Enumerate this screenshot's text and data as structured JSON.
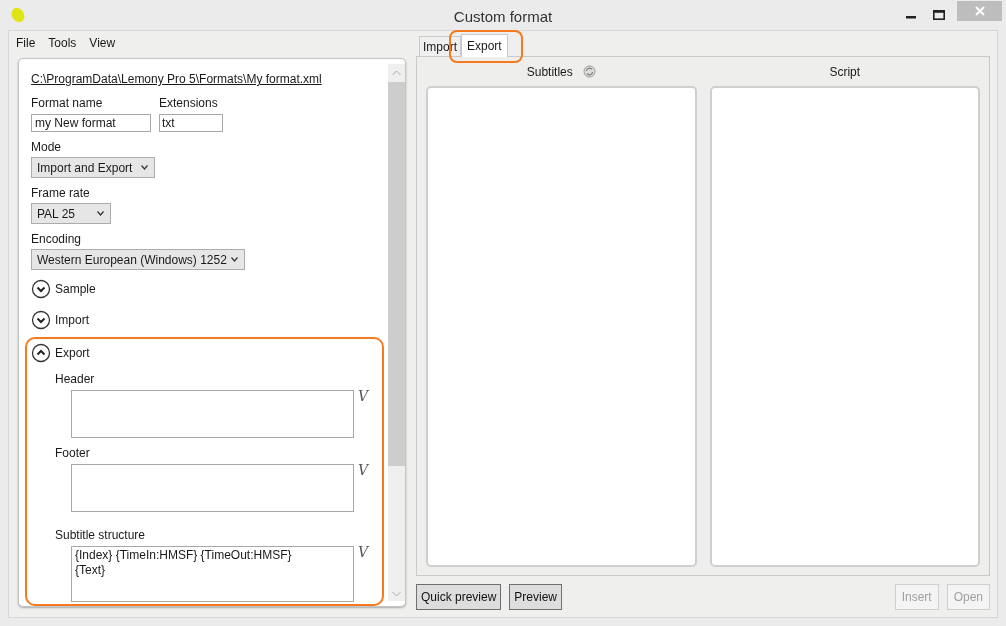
{
  "window": {
    "title": "Custom format"
  },
  "menu": [
    "File",
    "Tools",
    "View"
  ],
  "left_panel": {
    "path": "C:\\ProgramData\\Lemony Pro 5\\Formats\\My format.xml",
    "format_name": {
      "label": "Format name",
      "value": "my New format"
    },
    "extensions": {
      "label": "Extensions",
      "value": "txt"
    },
    "dropdowns": [
      {
        "label": "Mode",
        "value": "Import and Export"
      },
      {
        "label": "Frame rate",
        "value": "PAL 25"
      },
      {
        "label": "Encoding",
        "value": "Western European (Windows) 1252"
      }
    ],
    "sections": [
      {
        "label": "Sample",
        "expanded": false,
        "highlighted": false
      },
      {
        "label": "Import",
        "expanded": false,
        "highlighted": false
      },
      {
        "label": "Export",
        "expanded": true,
        "highlighted": true,
        "fields": [
          {
            "label": "Header",
            "variable_button": "V"
          },
          {
            "label": "Footer",
            "variable_button": "V"
          },
          {
            "label": "Subtitle structure",
            "value": "{Index} {TimeIn:HMSF} {TimeOut:HMSF}\n{Text}",
            "variable_button": "V"
          }
        ]
      }
    ]
  },
  "tabs": [
    {
      "label": "Import",
      "selected": false,
      "highlighted": false
    },
    {
      "label": "Export",
      "selected": true,
      "highlighted": true
    }
  ],
  "panes": [
    {
      "title": "Subtitles",
      "refresh_icon": true
    },
    {
      "title": "Script",
      "refresh_icon": false
    }
  ],
  "buttons_left": [
    {
      "label": "Quick preview",
      "disabled": false
    },
    {
      "label": "Preview",
      "disabled": false
    }
  ],
  "buttons_right": [
    {
      "label": "Insert",
      "disabled": true
    },
    {
      "label": "Open",
      "disabled": true
    }
  ]
}
